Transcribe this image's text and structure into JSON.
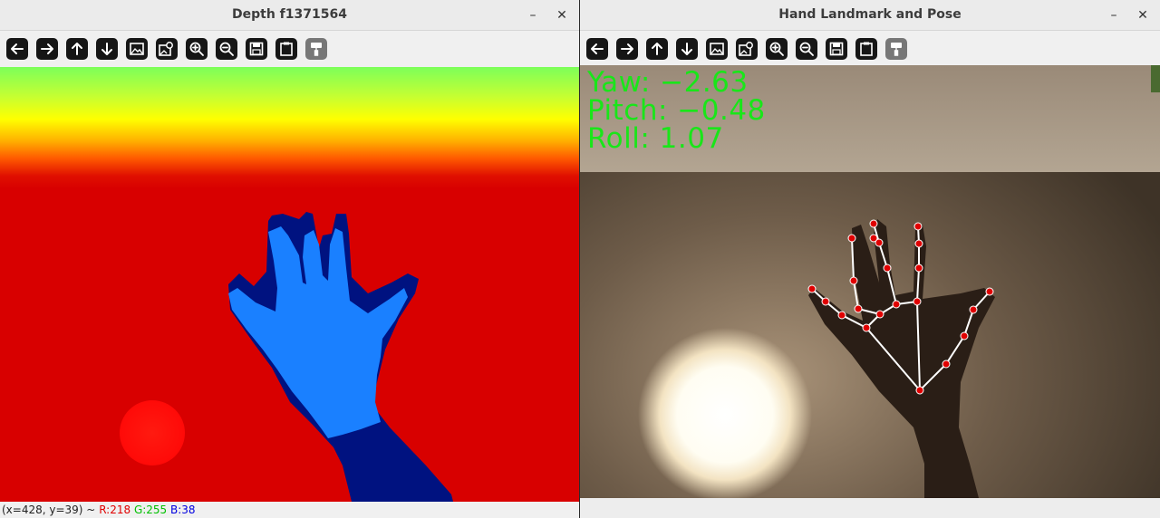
{
  "left_window": {
    "title": "Depth f1371564",
    "minimize_glyph": "–",
    "close_glyph": "✕",
    "toolbar": [
      {
        "name": "pan-left-button",
        "icon": "arrow-left-icon",
        "enabled": true
      },
      {
        "name": "pan-right-button",
        "icon": "arrow-right-icon",
        "enabled": true
      },
      {
        "name": "pan-up-button",
        "icon": "arrow-up-icon",
        "enabled": true
      },
      {
        "name": "pan-down-button",
        "icon": "arrow-down-icon",
        "enabled": true
      },
      {
        "name": "zoom-fit-button",
        "icon": "image-icon",
        "enabled": true
      },
      {
        "name": "zoom-original-button",
        "icon": "image-zoom-icon",
        "enabled": true
      },
      {
        "name": "zoom-in-button",
        "icon": "zoom-in-icon",
        "enabled": true
      },
      {
        "name": "zoom-out-button",
        "icon": "zoom-out-icon",
        "enabled": true
      },
      {
        "name": "save-button",
        "icon": "save-icon",
        "enabled": true
      },
      {
        "name": "copy-button",
        "icon": "clipboard-icon",
        "enabled": true
      },
      {
        "name": "properties-button",
        "icon": "paint-roller-icon",
        "enabled": false
      }
    ],
    "status": {
      "coords": "(x=428, y=39) ~",
      "r": "R:218",
      "g": "G:255",
      "b": "B:38"
    },
    "colors": {
      "background_red": "#d80000",
      "hand_light_blue": "#1a80ff",
      "hand_dark_blue": "#001280",
      "blob_red": "#ff0d0d"
    }
  },
  "right_window": {
    "title": "Hand Landmark and Pose",
    "minimize_glyph": "–",
    "close_glyph": "✕",
    "toolbar": [
      {
        "name": "pan-left-button",
        "icon": "arrow-left-icon",
        "enabled": true
      },
      {
        "name": "pan-right-button",
        "icon": "arrow-right-icon",
        "enabled": true
      },
      {
        "name": "pan-up-button",
        "icon": "arrow-up-icon",
        "enabled": true
      },
      {
        "name": "pan-down-button",
        "icon": "arrow-down-icon",
        "enabled": true
      },
      {
        "name": "zoom-fit-button",
        "icon": "image-icon",
        "enabled": true
      },
      {
        "name": "zoom-original-button",
        "icon": "image-zoom-icon",
        "enabled": true
      },
      {
        "name": "zoom-in-button",
        "icon": "zoom-in-icon",
        "enabled": true
      },
      {
        "name": "zoom-out-button",
        "icon": "zoom-out-icon",
        "enabled": true
      },
      {
        "name": "save-button",
        "icon": "save-icon",
        "enabled": true
      },
      {
        "name": "copy-button",
        "icon": "clipboard-icon",
        "enabled": true
      },
      {
        "name": "properties-button",
        "icon": "paint-roller-icon",
        "enabled": false
      }
    ],
    "overlay": {
      "yaw": "Yaw: −2.63",
      "pitch": "Pitch: −0.48",
      "roll": "Roll: 1.07"
    },
    "colors": {
      "overlay_text": "#19e619",
      "landmark_point": "#e00000",
      "landmark_edge": "#ffffff"
    }
  }
}
